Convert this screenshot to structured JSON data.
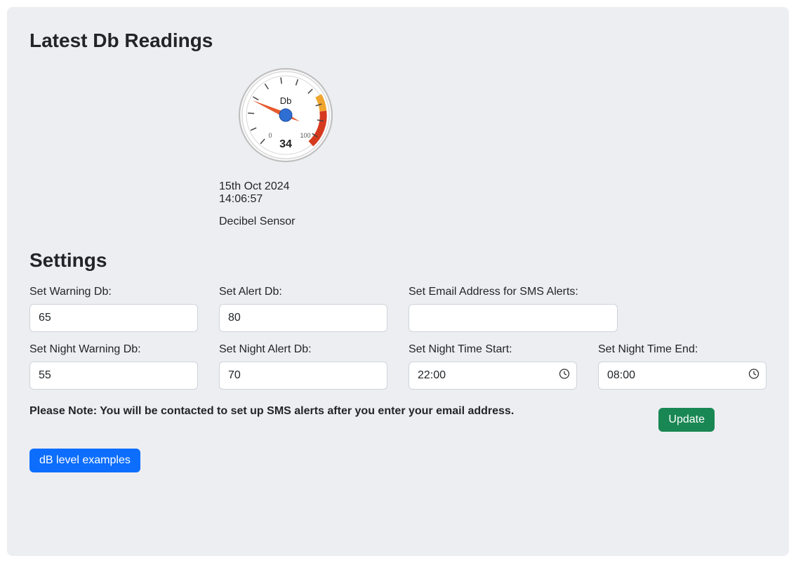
{
  "headings": {
    "latest": "Latest Db Readings",
    "settings": "Settings"
  },
  "reading": {
    "gauge_unit": "Db",
    "gauge_min": "0",
    "gauge_max": "100",
    "gauge_value": "34",
    "date": "15th Oct 2024",
    "time": "14:06:57",
    "sensor": "Decibel Sensor"
  },
  "settings": {
    "warning_db": {
      "label": "Set Warning Db:",
      "value": "65"
    },
    "alert_db": {
      "label": "Set Alert Db:",
      "value": "80"
    },
    "email": {
      "label": "Set Email Address for SMS Alerts:",
      "value": ""
    },
    "night_warning_db": {
      "label": "Set Night Warning Db:",
      "value": "55"
    },
    "night_alert_db": {
      "label": "Set Night Alert Db:",
      "value": "70"
    },
    "night_start": {
      "label": "Set Night Time Start:",
      "value": "22:00"
    },
    "night_end": {
      "label": "Set Night Time End:",
      "value": "08:00"
    }
  },
  "note": "Please Note: You will be contacted to set up SMS alerts after you enter your email address.",
  "buttons": {
    "update": "Update",
    "examples": "dB level examples"
  }
}
